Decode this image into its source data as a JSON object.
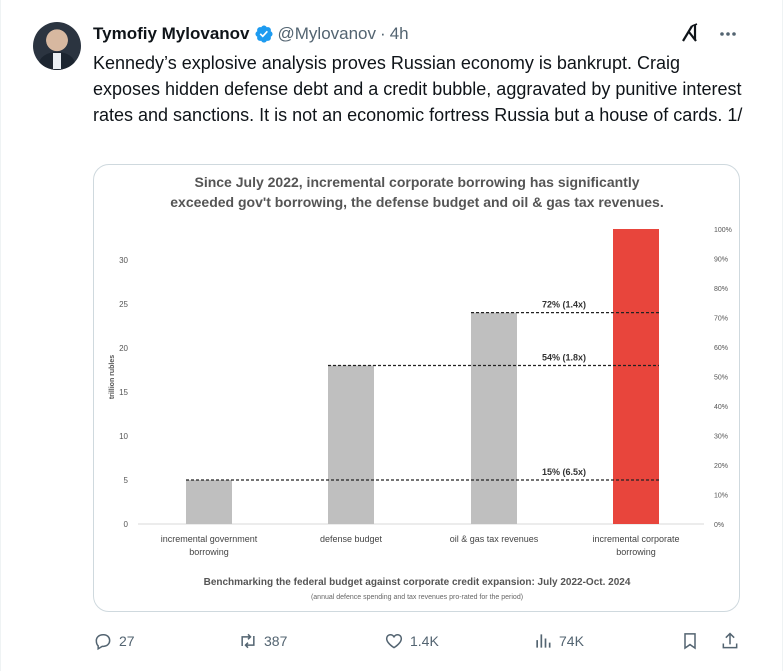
{
  "tweet": {
    "author_name": "Tymofiy Mylovanov",
    "handle": "@Mylovanov",
    "separator": "·",
    "time": "4h",
    "text": "Kennedy’s explosive analysis proves Russian economy is bankrupt. Craig exposes hidden defense debt and a credit bubble, aggravated by punitive interest rates and sanctions. It is not an economic fortress Russia but a house of cards. 1/"
  },
  "icons": {
    "verified": "verified-badge-icon",
    "grok": "grok-icon",
    "more": "more-icon",
    "reply": "reply-icon",
    "retweet": "retweet-icon",
    "like": "like-icon",
    "views": "views-icon",
    "bookmark": "bookmark-icon",
    "share": "share-icon"
  },
  "colors": {
    "verified_blue": "#1d9bf0",
    "bar_gray": "#bfbfbf",
    "bar_red": "#e8453c",
    "secondary_text": "#536471"
  },
  "actions": {
    "replies": "27",
    "reposts": "387",
    "likes": "1.4K",
    "views": "74K"
  },
  "chart_data": {
    "type": "bar",
    "title_line1": "Since July 2022, incremental corporate borrowing has significantly",
    "title_line2": "exceeded gov't borrowing, the defense budget and oil & gas tax revenues.",
    "ylabel": "trillion rubles",
    "categories": [
      [
        "incremental government",
        "borrowing"
      ],
      [
        "defense budget"
      ],
      [
        "oil & gas tax revenues"
      ],
      [
        "incremental corporate",
        "borrowing"
      ]
    ],
    "values": [
      5,
      18,
      24,
      33.5
    ],
    "bar_colors": [
      "#bfbfbf",
      "#bfbfbf",
      "#bfbfbf",
      "#e8453c"
    ],
    "ylim": [
      0,
      33.5
    ],
    "yticks": [
      0,
      5,
      10,
      15,
      20,
      25,
      30
    ],
    "y2ticks": [
      "0%",
      "10%",
      "20%",
      "30%",
      "40%",
      "50%",
      "60%",
      "70%",
      "80%",
      "90%",
      "100%"
    ],
    "annotations": [
      {
        "value": 24,
        "label": "72% (1.4x)"
      },
      {
        "value": 18,
        "label": "54% (1.8x)"
      },
      {
        "value": 5,
        "label": "15% (6.5x)"
      }
    ],
    "footer": "Benchmarking  the federal budget against corporate credit expansion: July 2022-Oct. 2024",
    "footnote": "(annual defence spending and tax revenues pro-rated for the period)"
  }
}
